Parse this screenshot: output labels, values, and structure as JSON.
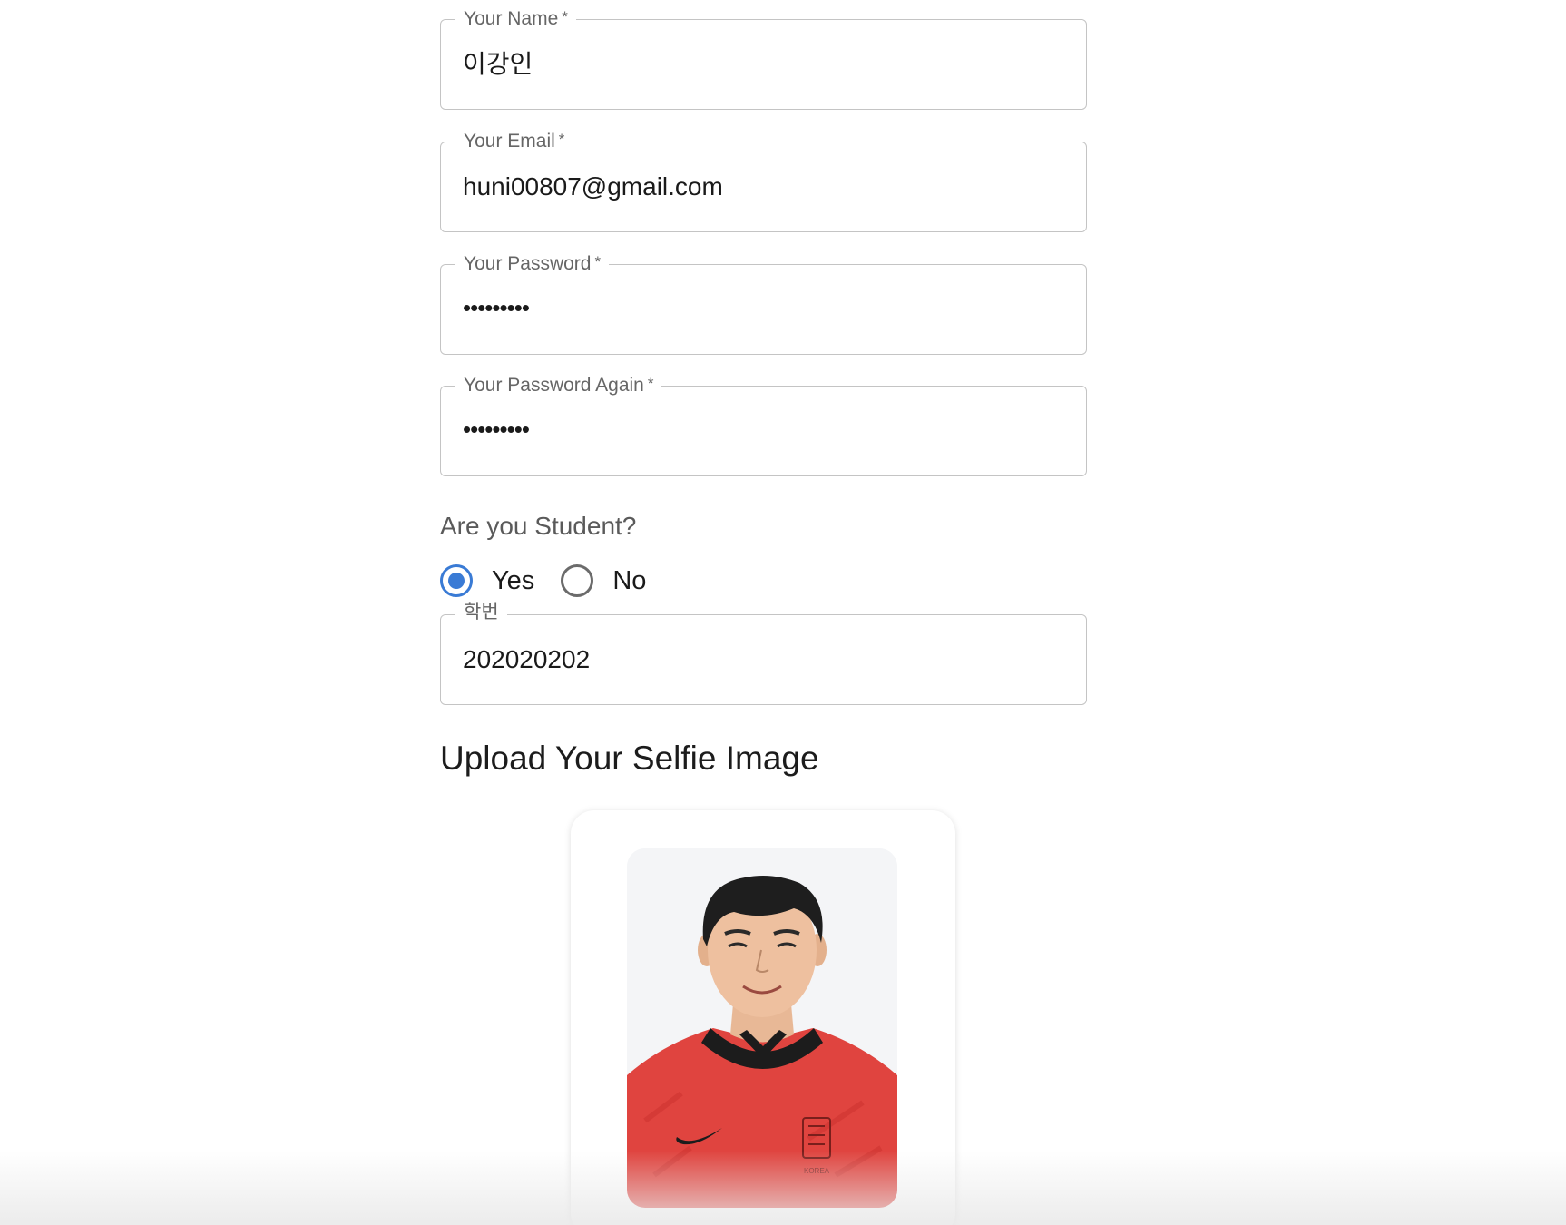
{
  "form": {
    "name": {
      "label": "Your Name",
      "required_mark": "*",
      "value": "이강인"
    },
    "email": {
      "label": "Your Email",
      "required_mark": "*",
      "value": "huni00807@gmail.com"
    },
    "password": {
      "label": "Your Password",
      "required_mark": "*",
      "value": "•••••••••"
    },
    "password_again": {
      "label": "Your Password Again",
      "required_mark": "*",
      "value": "•••••••••"
    },
    "student_question": "Are you Student?",
    "student_options": [
      {
        "label": "Yes",
        "selected": true
      },
      {
        "label": "No",
        "selected": false
      }
    ],
    "student_id": {
      "label": "학번",
      "value": "202020202"
    },
    "upload_title": "Upload Your Selfie Image",
    "jersey_badge_text": "KOREA"
  },
  "colors": {
    "accent": "#3a7bd5",
    "border": "#c4c4c4",
    "label": "#666666",
    "jersey_red": "#e0443f"
  }
}
